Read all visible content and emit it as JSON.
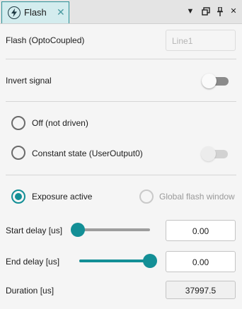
{
  "panel": {
    "tab_title": "Flash",
    "tab_icon": "lightning-icon",
    "accent_color": "#138f96",
    "window_controls": [
      "dropdown-arrow-icon",
      "restore-window-icon",
      "pin-icon",
      "close-icon"
    ]
  },
  "flash_output": {
    "label": "Flash (OptoCoupled)",
    "line_value": "Line1"
  },
  "invert_signal": {
    "label": "Invert signal",
    "enabled": false
  },
  "mode_options": [
    {
      "label": "Off (not driven)",
      "checked": false
    },
    {
      "label": "Constant state (UserOutput0)",
      "checked": false
    }
  ],
  "constant_state_toggle": {
    "enabled": false,
    "disabled": true
  },
  "trigger_options": [
    {
      "label": "Exposure active",
      "checked": true
    },
    {
      "label": "Global flash window",
      "checked": false,
      "disabled": true
    }
  ],
  "start_delay": {
    "label": "Start delay [us]",
    "value": "0.00",
    "slider_fraction": 0.0
  },
  "end_delay": {
    "label": "End delay [us]",
    "value": "0.00",
    "slider_fraction": 1.0
  },
  "duration": {
    "label": "Duration [us]",
    "value": "37997.5"
  }
}
